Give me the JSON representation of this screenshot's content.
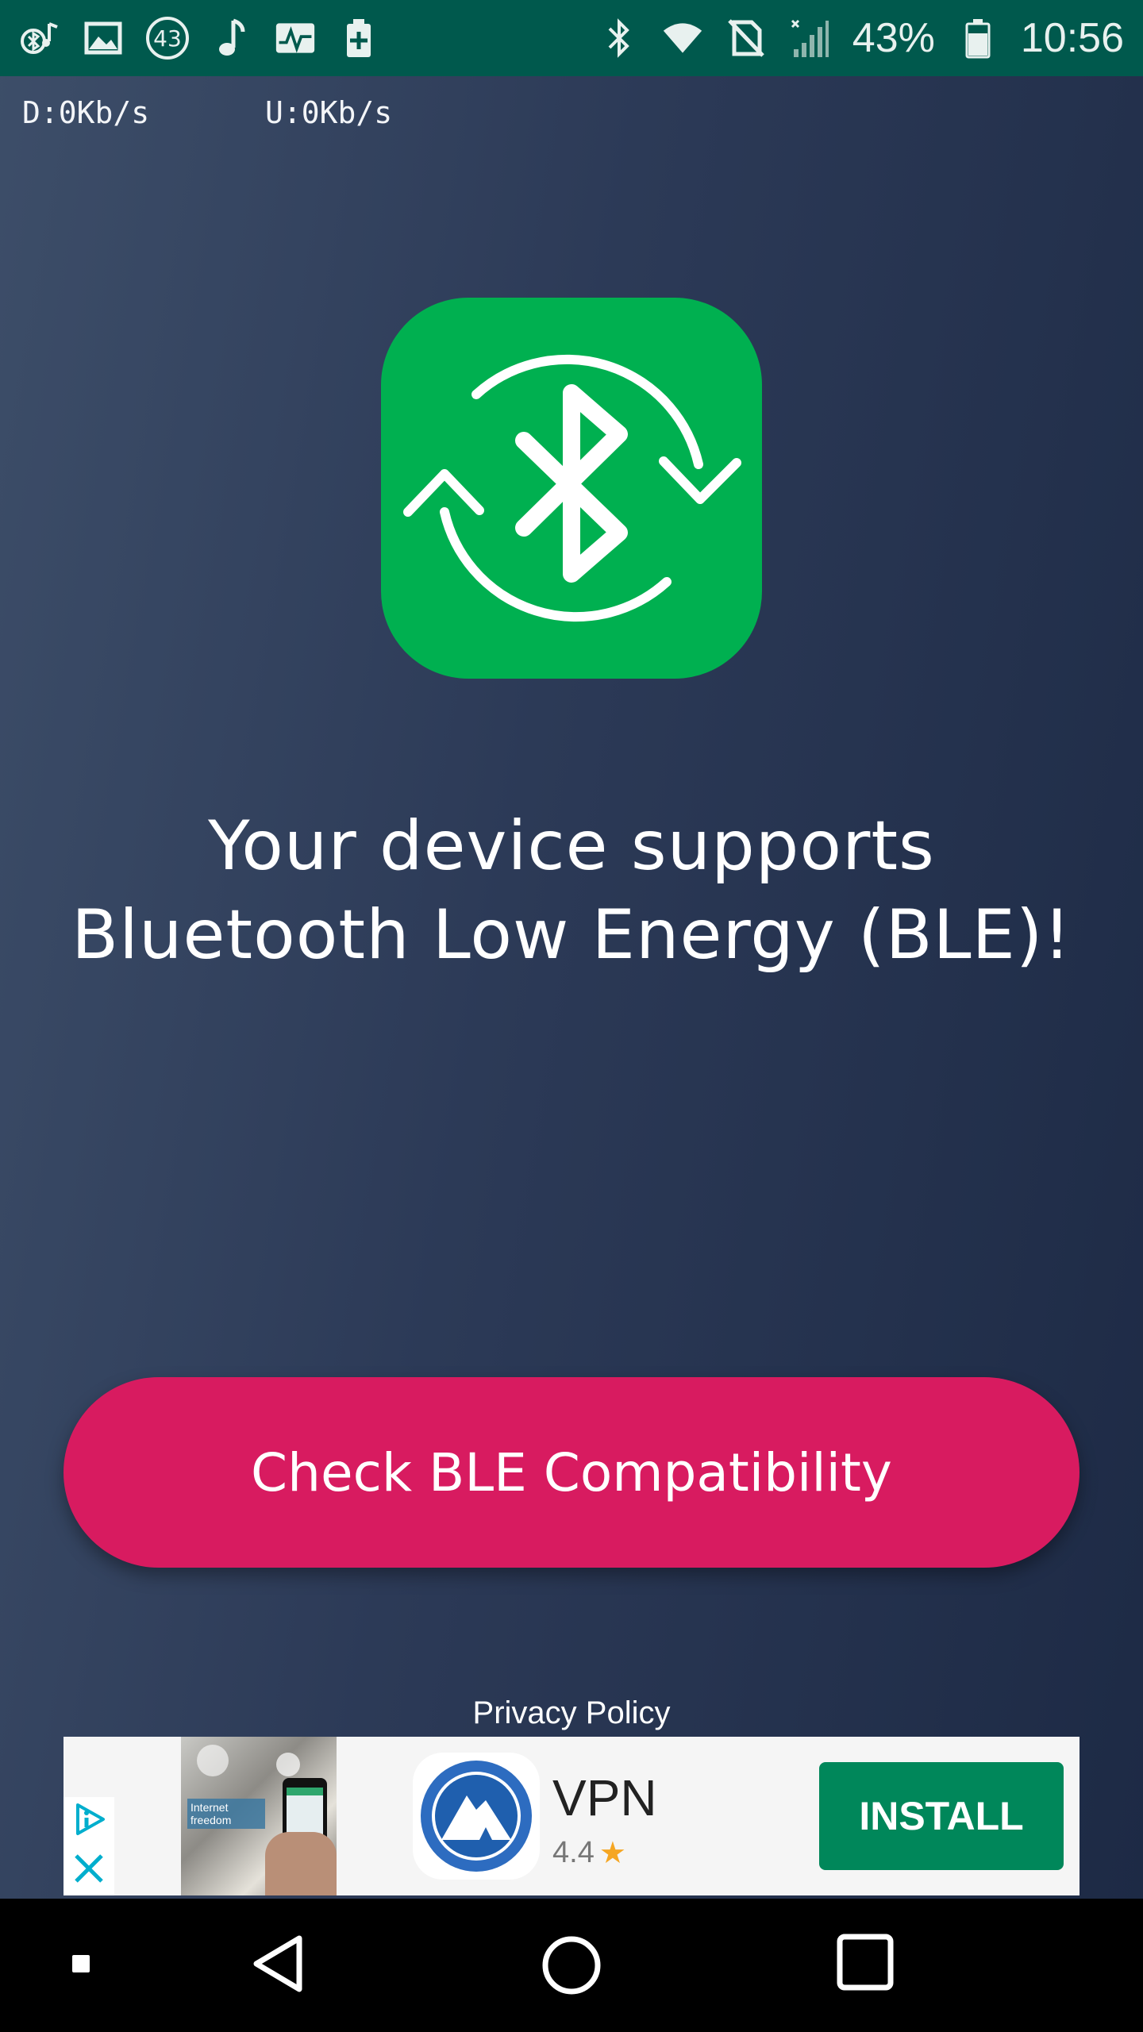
{
  "status_bar": {
    "notification_badge": "43",
    "battery_percent": "43%",
    "time": "10:56",
    "icons": [
      "bluetooth-music-icon",
      "image-icon",
      "badge-43-icon",
      "music-note-icon",
      "activity-icon",
      "battery-plus-icon",
      "bluetooth-icon",
      "wifi-icon",
      "no-sim-icon",
      "signal-icon",
      "battery-icon"
    ]
  },
  "network": {
    "download": "D:0Kb/s",
    "upload": "U:0Kb/s"
  },
  "main": {
    "app_icon": "bluetooth-sync-icon",
    "headline_line1": "Your device supports",
    "headline_line2": "Bluetooth Low Energy (BLE)!",
    "check_button_label": "Check BLE Compatibility",
    "privacy_link": "Privacy Policy"
  },
  "ad": {
    "photo_caption": "Internet freedom",
    "app_name": "VPN",
    "rating": "4.4",
    "install_label": "INSTALL"
  },
  "colors": {
    "status_bar": "#00594d",
    "app_icon_bg": "#00b050",
    "button_bg": "#d81b60",
    "install_bg": "#00875a",
    "background": "#2c3a57"
  }
}
